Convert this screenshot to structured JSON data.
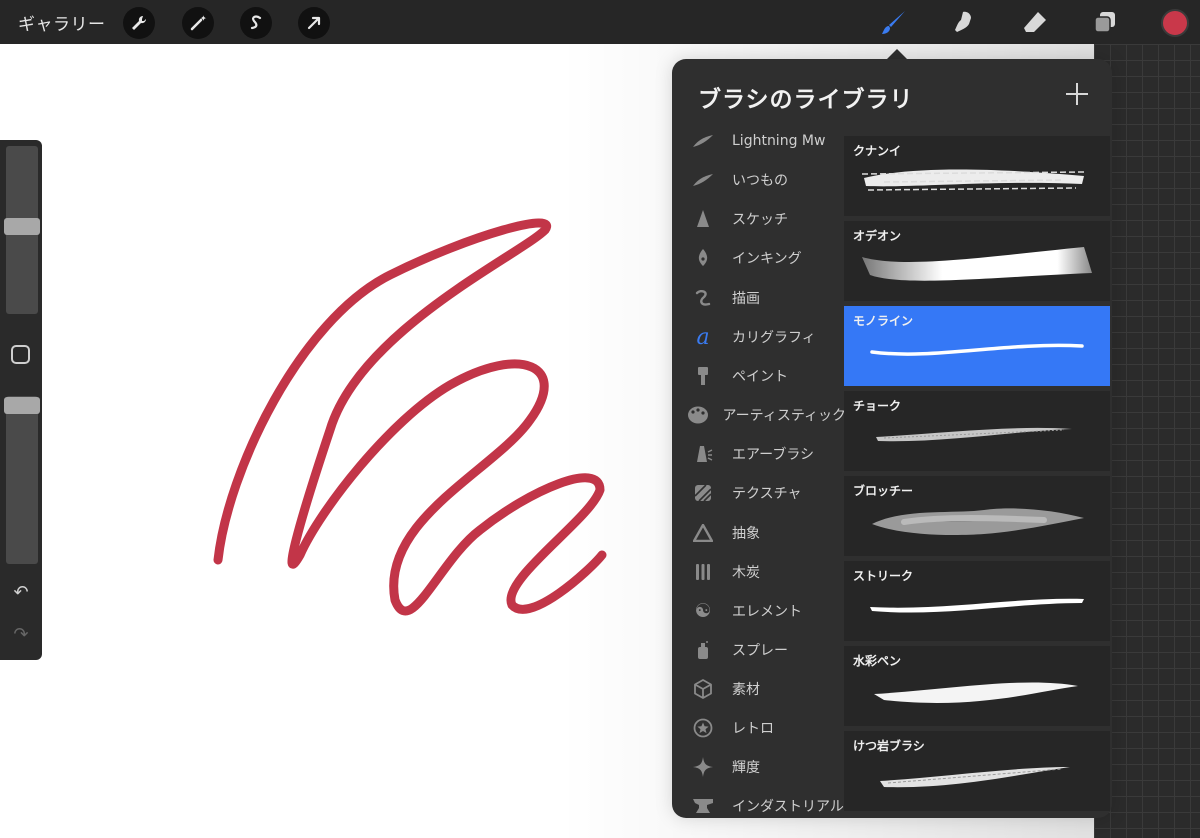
{
  "toolbar": {
    "gallery_label": "ギャラリー",
    "left_tools": [
      "wrench-icon",
      "magic-wand-icon",
      "selection-s-icon",
      "transform-arrow-icon"
    ],
    "right_tools": [
      "brush-icon",
      "smudge-icon",
      "eraser-icon",
      "layers-icon"
    ],
    "active_tool": "brush-icon",
    "current_color": "#c9384a"
  },
  "sidebar": {
    "modify_button": "square-icon",
    "undo_icon": "undo-icon",
    "redo_icon": "redo-icon"
  },
  "panel": {
    "title": "ブラシのライブラリ",
    "add_icon": "plus-icon",
    "sets": [
      {
        "label": "Lightning Mw",
        "icon": "stroke-icon"
      },
      {
        "label": "いつもの",
        "icon": "stroke-icon"
      },
      {
        "label": "スケッチ",
        "icon": "pencil-tip-icon"
      },
      {
        "label": "インキング",
        "icon": "pen-nib-icon"
      },
      {
        "label": "描画",
        "icon": "squiggle-icon"
      },
      {
        "label": "カリグラフィ",
        "icon": "calligraphy-a-icon"
      },
      {
        "label": "ペイント",
        "icon": "paint-brush-icon"
      },
      {
        "label": "アーティスティック",
        "icon": "palette-icon"
      },
      {
        "label": "エアーブラシ",
        "icon": "airbrush-icon"
      },
      {
        "label": "テクスチャ",
        "icon": "texture-icon"
      },
      {
        "label": "抽象",
        "icon": "triangle-icon"
      },
      {
        "label": "木炭",
        "icon": "charcoal-icon"
      },
      {
        "label": "エレメント",
        "icon": "yin-yang-icon"
      },
      {
        "label": "スプレー",
        "icon": "spray-can-icon"
      },
      {
        "label": "素材",
        "icon": "cube-icon"
      },
      {
        "label": "レトロ",
        "icon": "star-badge-icon"
      },
      {
        "label": "輝度",
        "icon": "sparkle-icon"
      },
      {
        "label": "インダストリアル",
        "icon": "anvil-icon"
      }
    ],
    "brushes": [
      {
        "name": "クナンイ"
      },
      {
        "name": "オデオン"
      },
      {
        "name": "モノライン"
      },
      {
        "name": "チョーク"
      },
      {
        "name": "ブロッチー"
      },
      {
        "name": "ストリーク"
      },
      {
        "name": "水彩ペン"
      },
      {
        "name": "けつ岩ブラシ"
      }
    ],
    "selected_brush": "モノライン",
    "selected_color": "#3578f6"
  }
}
